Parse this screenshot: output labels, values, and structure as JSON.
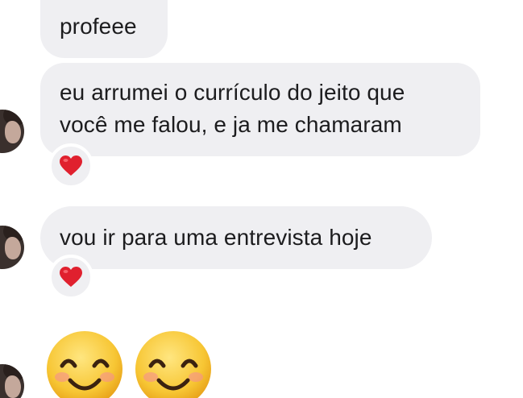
{
  "conversation": {
    "messages": [
      {
        "text": "profeee"
      },
      {
        "line1": "eu arrumei o currículo do jeito que",
        "line2": "você me falou, e ja me chamaram",
        "reaction": "red-heart-emoji"
      },
      {
        "text": "vou ir para uma entrevista hoje",
        "reaction": "red-heart-emoji"
      },
      {
        "emojis": [
          "smiling-face-with-smiling-eyes",
          "smiling-face-with-smiling-eyes"
        ]
      }
    ]
  },
  "colors": {
    "bubble_background": "#efeff2",
    "text": "#1c1c1e",
    "heart": "#e0202e",
    "emoji_face": "#f5c33b"
  }
}
